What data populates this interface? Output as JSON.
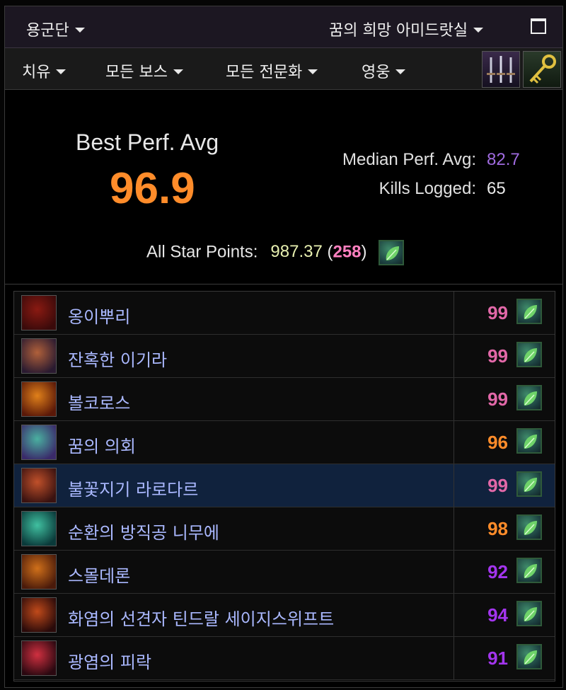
{
  "header": {
    "region_dropdown": "용군단",
    "raid_dropdown": "꿈의 희망 아미드랏실"
  },
  "filters": {
    "role": "치유",
    "boss": "모든 보스",
    "spec": "모든 전문화",
    "difficulty": "영웅"
  },
  "summary": {
    "best_label": "Best Perf. Avg",
    "best_value": "96.9",
    "median_label": "Median Perf. Avg:",
    "median_value": "82.7",
    "kills_label": "Kills Logged:",
    "kills_value": "65",
    "star_label": "All Star Points:",
    "star_value": "987.37",
    "star_paren_open": "(",
    "star_rank": "258",
    "star_paren_close": ")"
  },
  "colors": {
    "legendary": "#ff8c2a",
    "astounding": "#e268a8",
    "epic": "#a335ee",
    "median": "#a06be0"
  },
  "bosses": [
    {
      "name": "옹이뿌리",
      "score": "99",
      "score_color": "#e268a8",
      "avatar": [
        "#8a1a12",
        "#3a0a0a"
      ],
      "selected": false
    },
    {
      "name": "잔혹한 이기라",
      "score": "99",
      "score_color": "#e268a8",
      "avatar": [
        "#b0603a",
        "#2a1a30"
      ],
      "selected": false
    },
    {
      "name": "볼코로스",
      "score": "99",
      "score_color": "#e268a8",
      "avatar": [
        "#e0801a",
        "#5a1808"
      ],
      "selected": false
    },
    {
      "name": "꿈의 의회",
      "score": "96",
      "score_color": "#ff8c2a",
      "avatar": [
        "#4ab0a0",
        "#3a2a6a"
      ],
      "selected": false
    },
    {
      "name": "불꽃지기 라로다르",
      "score": "99",
      "score_color": "#e268a8",
      "avatar": [
        "#c0502a",
        "#3a1210"
      ],
      "selected": true
    },
    {
      "name": "순환의 방직공 니무에",
      "score": "98",
      "score_color": "#ff8c2a",
      "avatar": [
        "#40c0a0",
        "#0a3a3a"
      ],
      "selected": false
    },
    {
      "name": "스몰데론",
      "score": "92",
      "score_color": "#a335ee",
      "avatar": [
        "#d0701a",
        "#4a1a0a"
      ],
      "selected": false
    },
    {
      "name": "화염의 선견자 틴드랄 세이지스위프트",
      "score": "94",
      "score_color": "#a335ee",
      "avatar": [
        "#c04a1a",
        "#2a0a0a"
      ],
      "selected": false
    },
    {
      "name": "광염의 피락",
      "score": "91",
      "score_color": "#a335ee",
      "avatar": [
        "#d03040",
        "#2a0810"
      ],
      "selected": false
    }
  ]
}
